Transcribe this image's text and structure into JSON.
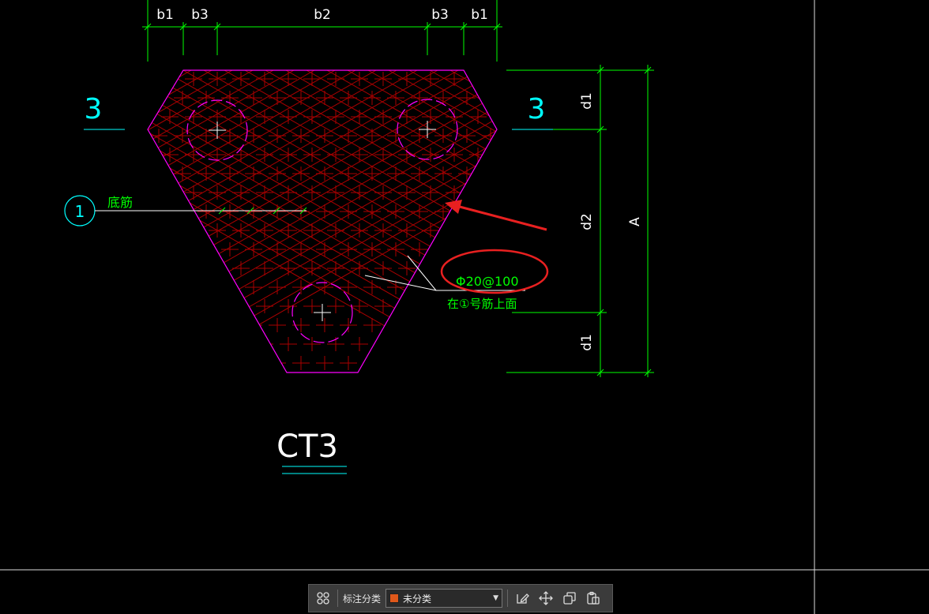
{
  "drawing": {
    "top_dims": [
      "b1",
      "b3",
      "b2",
      "b3",
      "b1"
    ],
    "right_dims": [
      "d1",
      "d2",
      "d1"
    ],
    "overall_dim": "A",
    "section_left": "3",
    "section_right": "3",
    "callout_number": "1",
    "callout_text": "底筋",
    "rebar_spec": "Φ20@100",
    "rebar_note": "在①号筋上面",
    "pile_cap_title": "CT3",
    "colors": {
      "outline": "#ff00ff",
      "rebar": "#aa0000",
      "dimension": "#00ff00",
      "annotation": "#00ffff",
      "highlight": "#e82020",
      "leader": "#ffffff"
    }
  },
  "toolbar": {
    "label": "标注分类",
    "category_value": "未分类",
    "category_color": "#e0581a",
    "icons": [
      "grid-icon",
      "edit-icon",
      "move-icon",
      "copy-icon",
      "paste-icon"
    ]
  }
}
